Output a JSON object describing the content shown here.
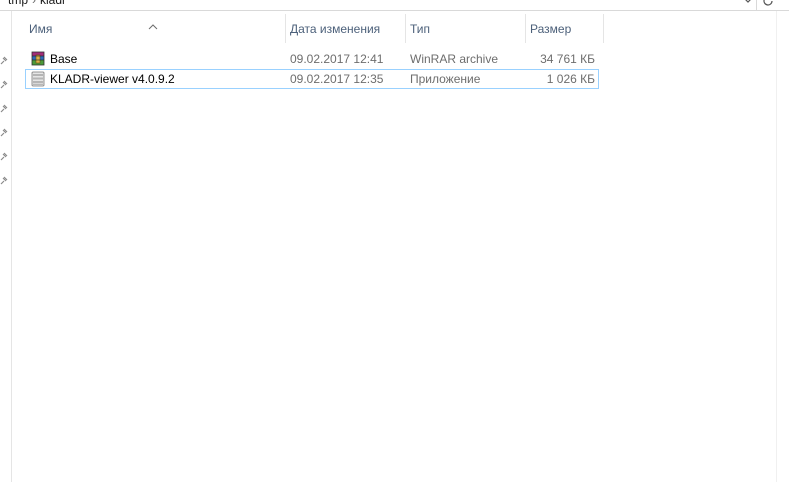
{
  "address": {
    "crumbs": [
      "tmp",
      "kladr"
    ],
    "separator": "›"
  },
  "columns": {
    "name": "Имя",
    "date": "Дата изменения",
    "type": "Тип",
    "size": "Размер"
  },
  "sort": {
    "column": "name",
    "direction": "ascending",
    "icon": "sort-up-arrow-icon"
  },
  "files": [
    {
      "name": "Base",
      "date": "09.02.2017 12:41",
      "type": "WinRAR archive",
      "size": "34 761 КБ",
      "icon": "winrar-archive-icon",
      "selected": false
    },
    {
      "name": "KLADR-viewer v4.0.9.2",
      "date": "09.02.2017 12:35",
      "type": "Приложение",
      "size": "1 026 КБ",
      "icon": "application-icon",
      "selected": true
    }
  ],
  "colors": {
    "header_text": "#4c607a",
    "detail_text": "#6d6d6d",
    "selection_border": "#99d1ff"
  }
}
